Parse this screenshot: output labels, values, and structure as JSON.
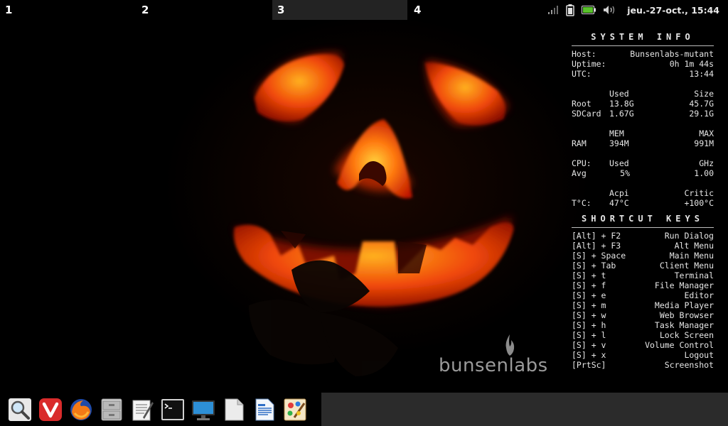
{
  "workspaces": [
    {
      "label": "1",
      "active": false
    },
    {
      "label": "2",
      "active": false
    },
    {
      "label": "3",
      "active": true
    },
    {
      "label": "4",
      "active": false
    }
  ],
  "tray": {
    "icons": [
      "signal-icon",
      "clipboard-icon",
      "battery-icon",
      "volume-icon"
    ],
    "clock": "jeu.-27-oct., 15:44"
  },
  "conky": {
    "system_heading": "SYSTEM INFO",
    "host_label": "Host:",
    "host_value": "Bunsenlabs-mutant",
    "uptime_label": "Uptime:",
    "uptime_value": "0h 1m 44s",
    "utc_label": "UTC:",
    "utc_value": "13:44",
    "disk_header": {
      "used": "Used",
      "size": "Size"
    },
    "disks": [
      {
        "name": "Root",
        "used": "13.8G",
        "size": "45.7G"
      },
      {
        "name": "SDCard",
        "used": "1.67G",
        "size": "29.1G"
      }
    ],
    "mem_header": {
      "mem": "MEM",
      "max": "MAX"
    },
    "ram": {
      "label": "RAM",
      "mem": "394M",
      "max": "991M"
    },
    "cpu_header": {
      "label": "CPU:",
      "used": "Used",
      "ghz": "GHz"
    },
    "cpu": {
      "label": "Avg",
      "used": "5%",
      "ghz": "1.00"
    },
    "temp_header": {
      "acpi": "Acpi",
      "critic": "Critic"
    },
    "temp": {
      "label": "T°C:",
      "acpi": "47°C",
      "critic": "+100°C"
    },
    "shortcut_heading": "SHORTCUT KEYS",
    "shortcuts": [
      {
        "keys": "[Alt] + F2",
        "action": "Run Dialog"
      },
      {
        "keys": "[Alt] + F3",
        "action": "Alt Menu"
      },
      {
        "keys": "[S] + Space",
        "action": "Main Menu"
      },
      {
        "keys": "[S] + Tab",
        "action": "Client Menu"
      },
      {
        "keys": "[S] + t",
        "action": "Terminal"
      },
      {
        "keys": "[S] + f",
        "action": "File Manager"
      },
      {
        "keys": "[S] + e",
        "action": "Editor"
      },
      {
        "keys": "[S] + m",
        "action": "Media Player"
      },
      {
        "keys": "[S] + w",
        "action": "Web Browser"
      },
      {
        "keys": "[S] + h",
        "action": "Task Manager"
      },
      {
        "keys": "[S] + l",
        "action": "Lock Screen"
      },
      {
        "keys": "[S] + v",
        "action": "Volume Control"
      },
      {
        "keys": "[S] + x",
        "action": "Logout"
      },
      {
        "keys": "[PrtSc]",
        "action": "Screenshot"
      }
    ]
  },
  "logo": {
    "text": "bunsenlabs"
  },
  "dock": {
    "apps": [
      {
        "name": "search-app-icon"
      },
      {
        "name": "vivaldi-browser-icon"
      },
      {
        "name": "firefox-browser-icon"
      },
      {
        "name": "file-manager-icon"
      },
      {
        "name": "text-editor-icon"
      },
      {
        "name": "terminal-icon"
      },
      {
        "name": "display-settings-icon"
      },
      {
        "name": "blank-document-icon"
      },
      {
        "name": "writer-document-icon"
      },
      {
        "name": "paint-app-icon"
      }
    ]
  },
  "colors": {
    "pumpkin_glow": "#ff3a00",
    "accent_yellow": "#ffd23c",
    "panel_dark": "#232323"
  }
}
